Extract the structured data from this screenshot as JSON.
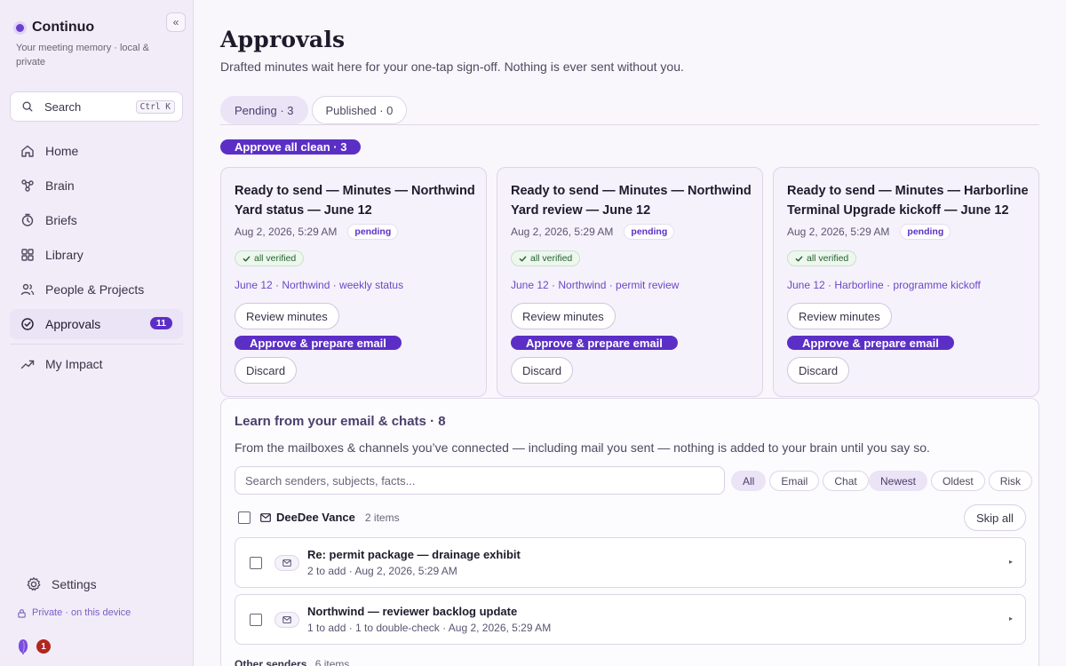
{
  "app": {
    "name": "Continuo",
    "tagline": "Your meeting memory · local & private",
    "collapse_label": "«"
  },
  "search": {
    "label": "Search",
    "shortcut": "Ctrl K"
  },
  "nav": [
    {
      "label": "Home",
      "icon": "home-icon"
    },
    {
      "label": "Brain",
      "icon": "brain-icon"
    },
    {
      "label": "Briefs",
      "icon": "clock-icon"
    },
    {
      "label": "Library",
      "icon": "grid-icon"
    },
    {
      "label": "People & Projects",
      "icon": "people-icon"
    },
    {
      "label": "Approvals",
      "icon": "check-circle-icon",
      "badge": "11",
      "active": true
    },
    {
      "label": "My Impact",
      "icon": "trend-icon"
    }
  ],
  "settings": {
    "label": "Settings"
  },
  "privacy_note": "Private · on this device",
  "notification_count": "1",
  "page": {
    "title": "Approvals",
    "subtitle": "Drafted minutes wait here for your one-tap sign-off. Nothing is ever sent without you."
  },
  "tabs": [
    {
      "label": "Pending · 3",
      "active": true
    },
    {
      "label": "Published · 0",
      "active": false
    }
  ],
  "approve_all_label": "Approve all clean · 3",
  "cards": [
    {
      "title": "Ready to send — Minutes — Northwind Yard status — June 12",
      "date": "Aug 2, 2026, 5:29 AM",
      "status": "pending",
      "verified": "all verified",
      "tags": "June 12 · Northwind · weekly status",
      "review_label": "Review minutes",
      "approve_label": "Approve & prepare email",
      "discard_label": "Discard"
    },
    {
      "title": "Ready to send — Minutes — Northwind Yard review — June 12",
      "date": "Aug 2, 2026, 5:29 AM",
      "status": "pending",
      "verified": "all verified",
      "tags": "June 12 · Northwind · permit review",
      "review_label": "Review minutes",
      "approve_label": "Approve & prepare email",
      "discard_label": "Discard"
    },
    {
      "title": "Ready to send — Minutes — Harborline Terminal Upgrade kickoff — June 12",
      "date": "Aug 2, 2026, 5:29 AM",
      "status": "pending",
      "verified": "all verified",
      "tags": "June 12 · Harborline · programme kickoff",
      "review_label": "Review minutes",
      "approve_label": "Approve & prepare email",
      "discard_label": "Discard"
    }
  ],
  "learn": {
    "title": "Learn from your email & chats · 8",
    "subtitle": "From the mailboxes & channels you’ve connected — including mail you sent — nothing is added to your brain until you say so.",
    "search_placeholder": "Search senders, subjects, facts...",
    "source_filters": [
      {
        "label": "All",
        "active": true
      },
      {
        "label": "Email",
        "active": false
      },
      {
        "label": "Chat",
        "active": false
      }
    ],
    "sort_filters": [
      {
        "label": "Newest",
        "active": true
      },
      {
        "label": "Oldest",
        "active": false
      },
      {
        "label": "Risk",
        "active": false
      }
    ],
    "sender": {
      "name": "DeeDee Vance",
      "count": "2 items",
      "skip_label": "Skip all"
    },
    "items": [
      {
        "subject": "Re: permit package — drainage exhibit",
        "meta": "2 to add · Aug 2, 2026, 5:29 AM"
      },
      {
        "subject": "Northwind — reviewer backlog update",
        "meta": "1 to add · 1 to double-check · Aug 2, 2026, 5:29 AM"
      }
    ],
    "other_senders": {
      "label": "Other senders",
      "count": "6 items"
    }
  },
  "colors": {
    "accent": "#5b2fc6",
    "sidebar_bg": "#f1ecf7",
    "verified_green": "#24612f",
    "badge_red": "#b3261e"
  }
}
